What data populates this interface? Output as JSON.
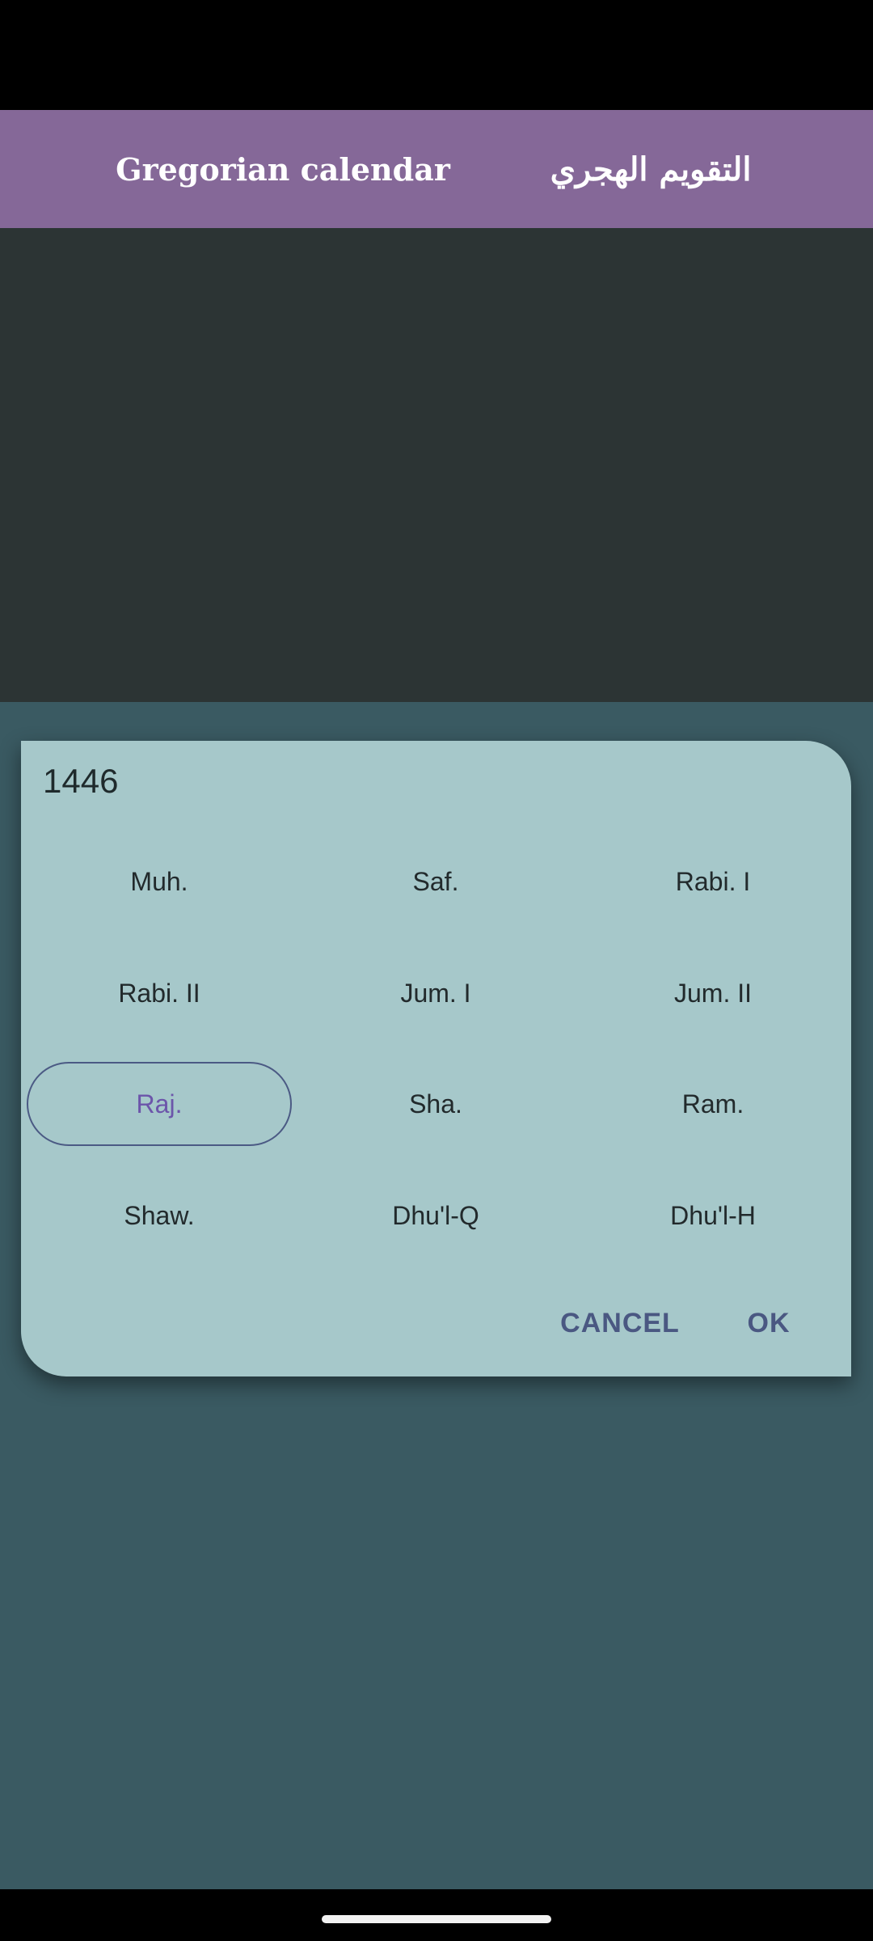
{
  "app_bar": {
    "tabs": [
      {
        "label": "Gregorian calendar"
      },
      {
        "label": "التقويم الهجري"
      }
    ]
  },
  "dialog": {
    "year": "1446",
    "months": [
      {
        "label": "Muh."
      },
      {
        "label": "Saf."
      },
      {
        "label": "Rabi. I"
      },
      {
        "label": "Rabi. II"
      },
      {
        "label": "Jum. I"
      },
      {
        "label": "Jum. II"
      },
      {
        "label": "Raj."
      },
      {
        "label": "Sha."
      },
      {
        "label": "Ram."
      },
      {
        "label": "Shaw."
      },
      {
        "label": "Dhu'l-Q"
      },
      {
        "label": "Dhu'l-H"
      }
    ],
    "selected_month": "Raj.",
    "cancel_label": "CANCEL",
    "ok_label": "OK"
  },
  "colors": {
    "app_bar": "#856898",
    "content_background": "#2c3434",
    "scrim": "#3a5a62",
    "dialog_background": "#a6c8ca",
    "accent": "#6c55aa",
    "action_text": "#4a5882"
  },
  "icons": {
    "home_indicator": "home-handle"
  }
}
